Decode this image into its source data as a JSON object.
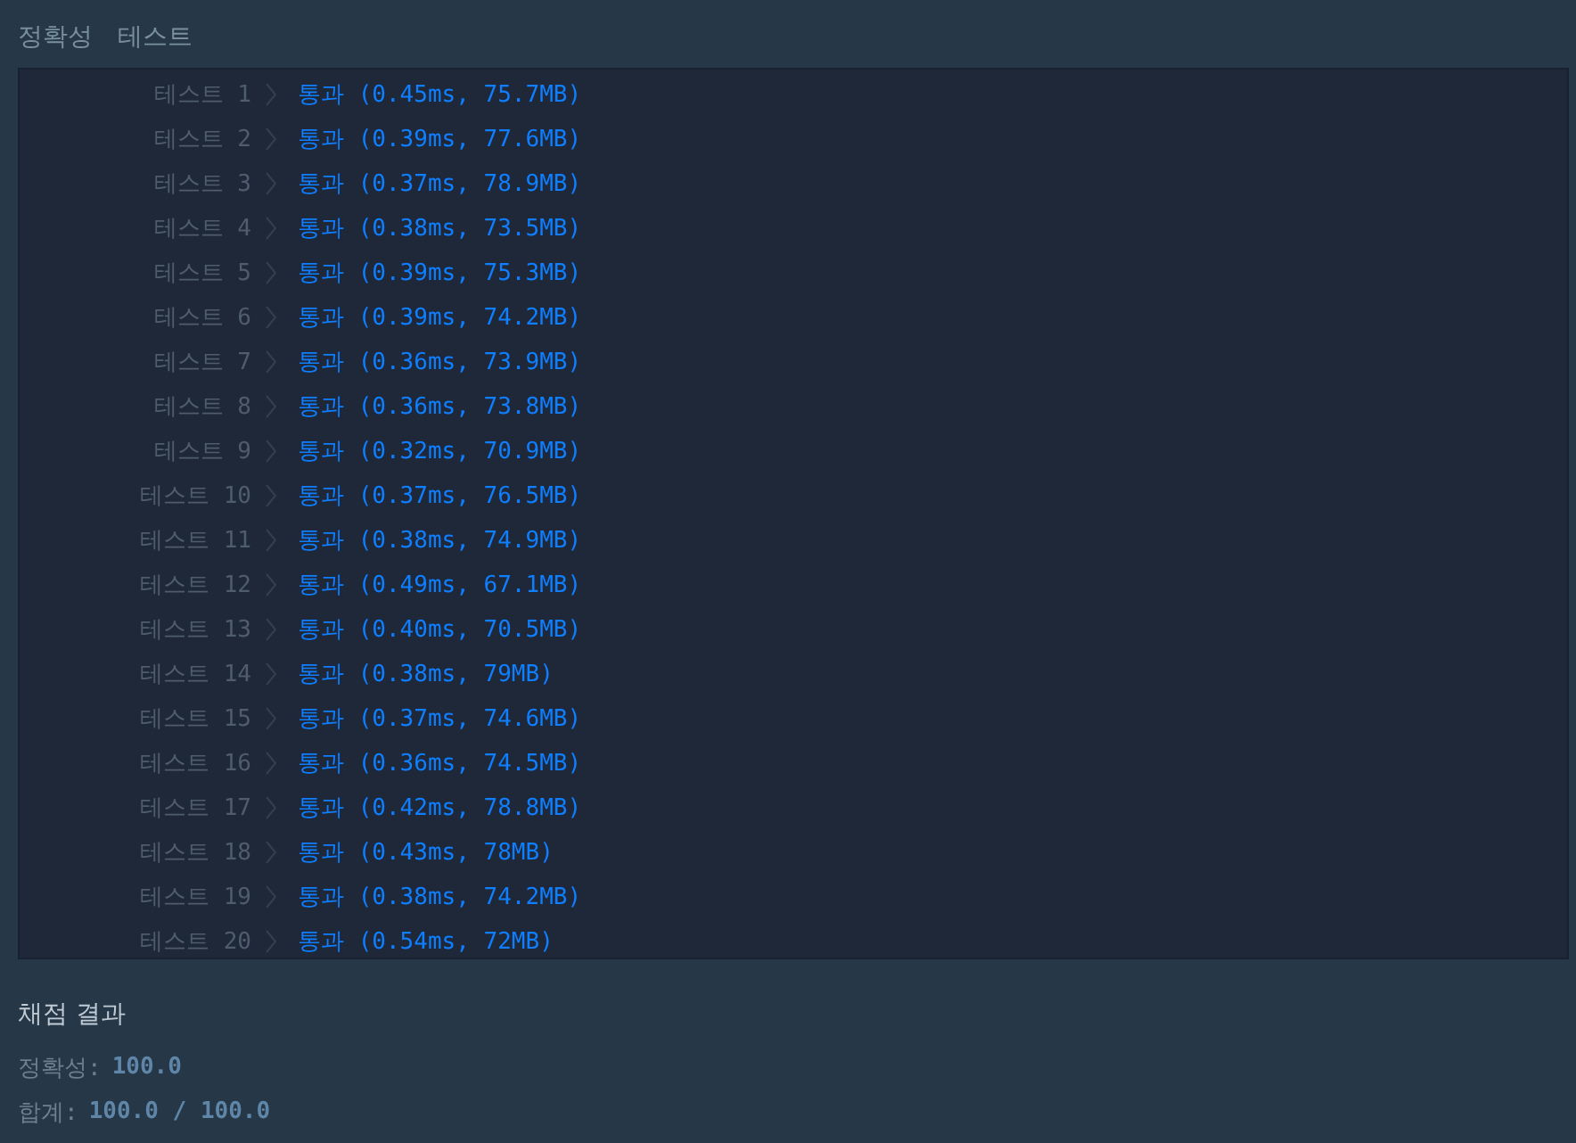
{
  "heading": {
    "title": "정확성",
    "subtitle": "테스트"
  },
  "tests": [
    {
      "label": "테스트 1",
      "result": "통과 (0.45ms, 75.7MB)"
    },
    {
      "label": "테스트 2",
      "result": "통과 (0.39ms, 77.6MB)"
    },
    {
      "label": "테스트 3",
      "result": "통과 (0.37ms, 78.9MB)"
    },
    {
      "label": "테스트 4",
      "result": "통과 (0.38ms, 73.5MB)"
    },
    {
      "label": "테스트 5",
      "result": "통과 (0.39ms, 75.3MB)"
    },
    {
      "label": "테스트 6",
      "result": "통과 (0.39ms, 74.2MB)"
    },
    {
      "label": "테스트 7",
      "result": "통과 (0.36ms, 73.9MB)"
    },
    {
      "label": "테스트 8",
      "result": "통과 (0.36ms, 73.8MB)"
    },
    {
      "label": "테스트 9",
      "result": "통과 (0.32ms, 70.9MB)"
    },
    {
      "label": "테스트 10",
      "result": "통과 (0.37ms, 76.5MB)"
    },
    {
      "label": "테스트 11",
      "result": "통과 (0.38ms, 74.9MB)"
    },
    {
      "label": "테스트 12",
      "result": "통과 (0.49ms, 67.1MB)"
    },
    {
      "label": "테스트 13",
      "result": "통과 (0.40ms, 70.5MB)"
    },
    {
      "label": "테스트 14",
      "result": "통과 (0.38ms, 79MB)"
    },
    {
      "label": "테스트 15",
      "result": "통과 (0.37ms, 74.6MB)"
    },
    {
      "label": "테스트 16",
      "result": "통과 (0.36ms, 74.5MB)"
    },
    {
      "label": "테스트 17",
      "result": "통과 (0.42ms, 78.8MB)"
    },
    {
      "label": "테스트 18",
      "result": "통과 (0.43ms, 78MB)"
    },
    {
      "label": "테스트 19",
      "result": "통과 (0.38ms, 74.2MB)"
    },
    {
      "label": "테스트 20",
      "result": "통과 (0.54ms, 72MB)"
    }
  ],
  "summary": {
    "title": "채점 결과",
    "lines": [
      {
        "label": "정확성:",
        "value": "100.0"
      },
      {
        "label": "합계:",
        "value": "100.0 / 100.0"
      }
    ]
  }
}
